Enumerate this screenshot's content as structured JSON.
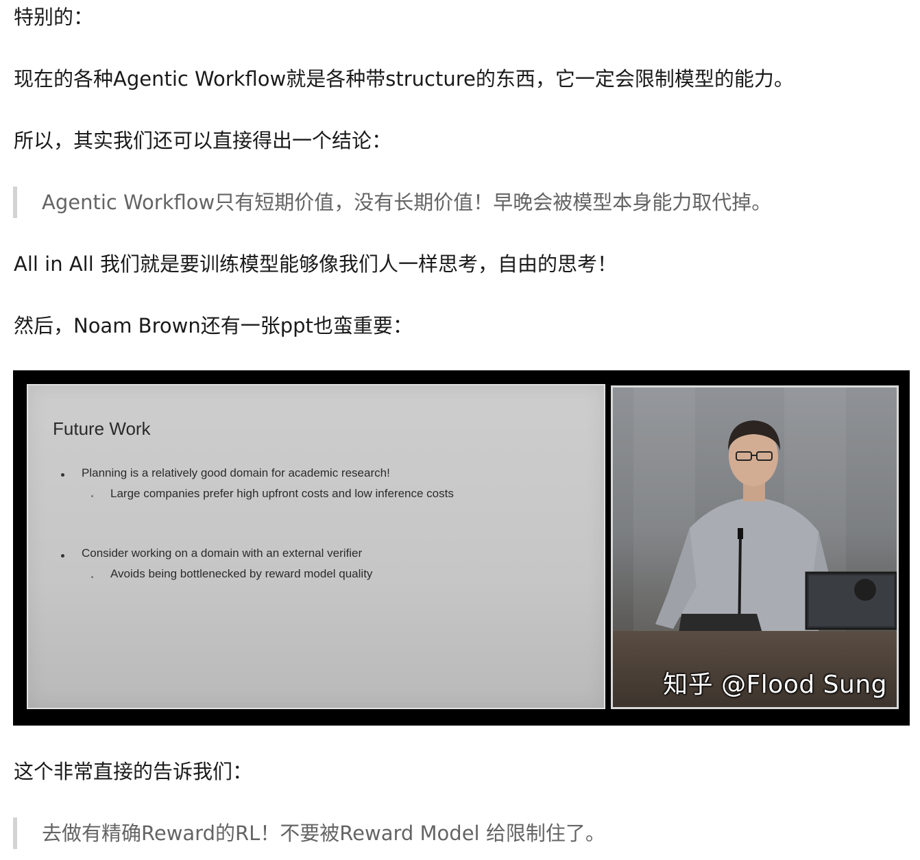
{
  "paragraphs": {
    "p1": "特别的：",
    "p2": "现在的各种Agentic Workflow就是各种带structure的东西，它一定会限制模型的能力。",
    "p3": "所以，其实我们还可以直接得出一个结论：",
    "q1": "Agentic Workflow只有短期价值，没有长期价值！早晚会被模型本身能力取代掉。",
    "p4": "All in All 我们就是要训练模型能够像我们人一样思考，自由的思考！",
    "p5": "然后，Noam Brown还有一张ppt也蛮重要：",
    "p6": "这个非常直接的告诉我们：",
    "q2": "去做有精确Reward的RL！不要被Reward Model 给限制住了。"
  },
  "slide": {
    "title": "Future Work",
    "bullets": [
      "Planning is a relatively good domain for academic research!",
      "Large companies prefer high upfront costs and low inference costs",
      "Consider working on a domain with an external verifier",
      "Avoids being bottlenecked by reward model quality"
    ]
  },
  "video": {
    "watermark": "知乎 @Flood Sung"
  },
  "colors": {
    "text": "#1a1a1a",
    "quote_text": "#646464",
    "quote_bar": "#d3d3d3",
    "figure_bg": "#000000"
  }
}
